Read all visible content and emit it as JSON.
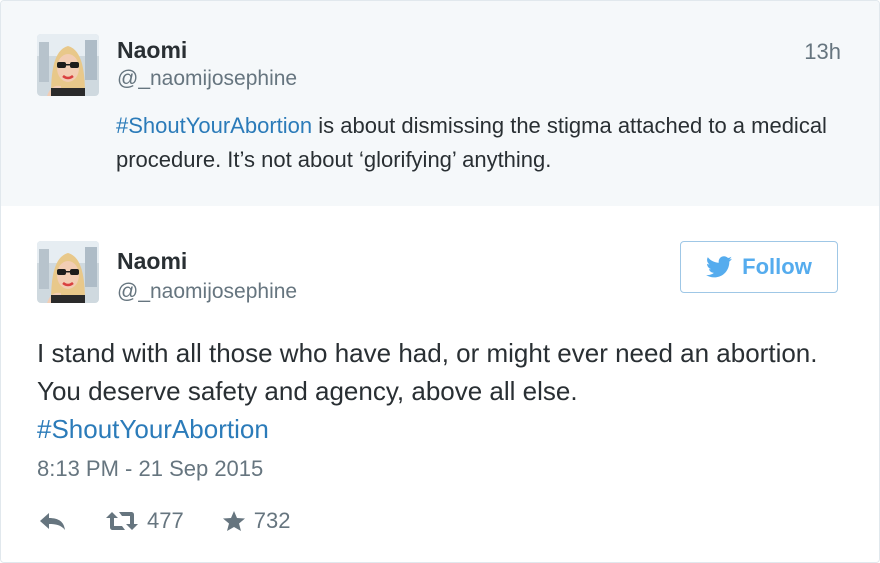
{
  "parent_tweet": {
    "name": "Naomi",
    "handle": "@_naomijosephine",
    "time": "13h",
    "hashtag": "#ShoutYourAbortion",
    "text": " is about dismissing the stigma attached to a medical procedure. It’s not about ‘glorifying’ anything."
  },
  "main_tweet": {
    "name": "Naomi",
    "handle": "@_naomijosephine",
    "follow_label": "Follow",
    "text": "I stand with all those who have had, or might ever need an abortion. You deserve safety and agency, above all else.",
    "hashtag": "#ShoutYourAbortion",
    "date": "8:13 PM - 21 Sep 2015",
    "actions": {
      "reply_icon": "reply-icon",
      "retweet_icon": "retweet-icon",
      "retweet_count": "477",
      "favorite_icon": "star-icon",
      "favorite_count": "732"
    }
  },
  "colors": {
    "link": "#2b7bb9",
    "twitter_blue": "#55acee",
    "secondary_text": "#66757f",
    "parent_background": "#f5f8fa"
  }
}
